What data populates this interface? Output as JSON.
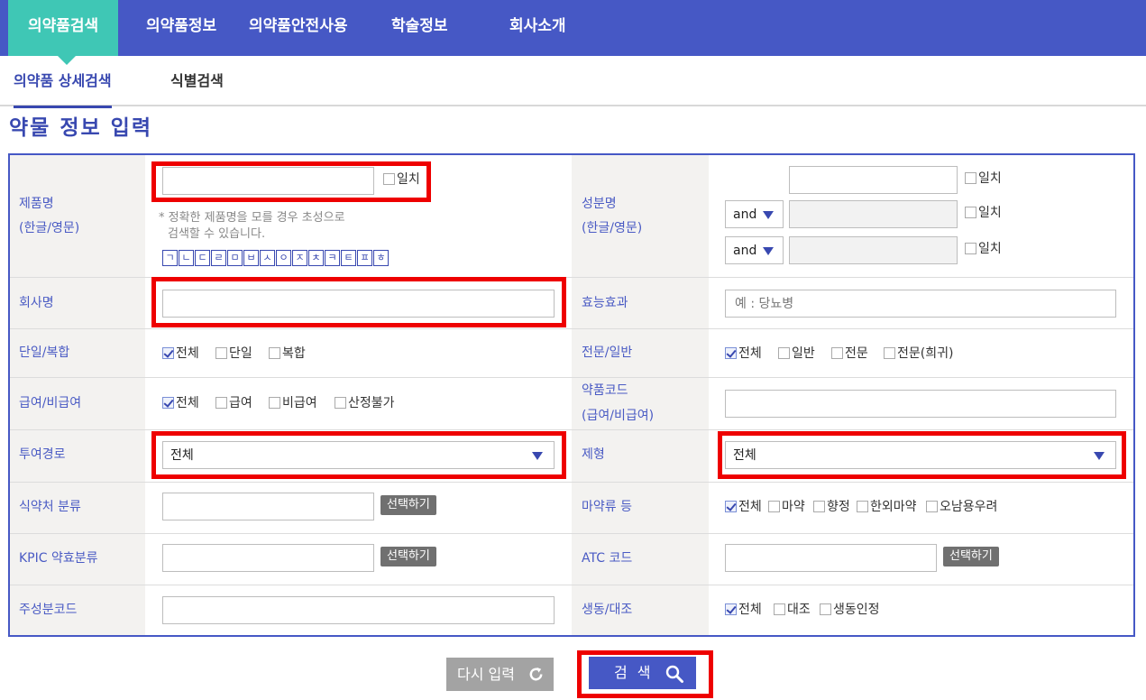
{
  "nav": {
    "items": [
      "의약품검색",
      "의약품정보",
      "의약품안전사용",
      "학술정보",
      "회사소개"
    ]
  },
  "subtabs": [
    "의약품 상세검색",
    "식별검색"
  ],
  "section_title": "약물 정보 입력",
  "form": {
    "product_name": {
      "label1": "제품명",
      "label2": "(한글/영문)",
      "exact": "일치",
      "note1": "* 정확한 제품명을 모를 경우 초성으로",
      "note2": "검색할 수 있습니다.",
      "jamo": [
        "ㄱ",
        "ㄴ",
        "ㄷ",
        "ㄹ",
        "ㅁ",
        "ㅂ",
        "ㅅ",
        "ㅇ",
        "ㅈ",
        "ㅊ",
        "ㅋ",
        "ㅌ",
        "ㅍ",
        "ㅎ"
      ]
    },
    "ingredient": {
      "label1": "성분명",
      "label2": "(한글/영문)",
      "exact": "일치",
      "op": "and"
    },
    "company": {
      "label": "회사명"
    },
    "efficacy": {
      "label": "효능효과",
      "placeholder": "예 : 당뇨병"
    },
    "single_combo": {
      "label": "단일/복합",
      "options": [
        {
          "text": "전체",
          "checked": true
        },
        {
          "text": "단일",
          "checked": false
        },
        {
          "text": "복합",
          "checked": false
        }
      ]
    },
    "prescription": {
      "label": "전문/일반",
      "options": [
        {
          "text": "전체",
          "checked": true
        },
        {
          "text": "일반",
          "checked": false
        },
        {
          "text": "전문",
          "checked": false
        },
        {
          "text": "전문(희귀)",
          "checked": false
        }
      ]
    },
    "insurance": {
      "label": "급여/비급여",
      "options": [
        {
          "text": "전체",
          "checked": true
        },
        {
          "text": "급여",
          "checked": false
        },
        {
          "text": "비급여",
          "checked": false
        },
        {
          "text": "산정불가",
          "checked": false
        }
      ]
    },
    "drug_code": {
      "label1": "약품코드",
      "label2": "(급여/비급여)"
    },
    "route": {
      "label": "투여경로",
      "selected": "전체"
    },
    "dosage_form": {
      "label": "제형",
      "selected": "전체"
    },
    "mfds_class": {
      "label": "식약처 분류",
      "button": "선택하기"
    },
    "narcotics": {
      "label": "마약류 등",
      "options": [
        {
          "text": "전체",
          "checked": true
        },
        {
          "text": "마약",
          "checked": false
        },
        {
          "text": "향정",
          "checked": false
        },
        {
          "text": "한외마약",
          "checked": false
        },
        {
          "text": "오남용우려",
          "checked": false
        }
      ]
    },
    "kpic_class": {
      "label": "KPIC 약효분류",
      "button": "선택하기"
    },
    "atc_code": {
      "label": "ATC 코드",
      "button": "선택하기"
    },
    "ingredient_code": {
      "label": "주성분코드"
    },
    "bioequivalence": {
      "label": "생동/대조",
      "options": [
        {
          "text": "전체",
          "checked": true
        },
        {
          "text": "대조",
          "checked": false
        },
        {
          "text": "생동인정",
          "checked": false
        }
      ]
    }
  },
  "buttons": {
    "reset": "다시 입력",
    "search": "검 색"
  },
  "colors": {
    "nav_bg": "#4658c5",
    "nav_active": "#3fc7b5",
    "label_text": "#4a5bc4",
    "highlight": "#ee0000"
  }
}
